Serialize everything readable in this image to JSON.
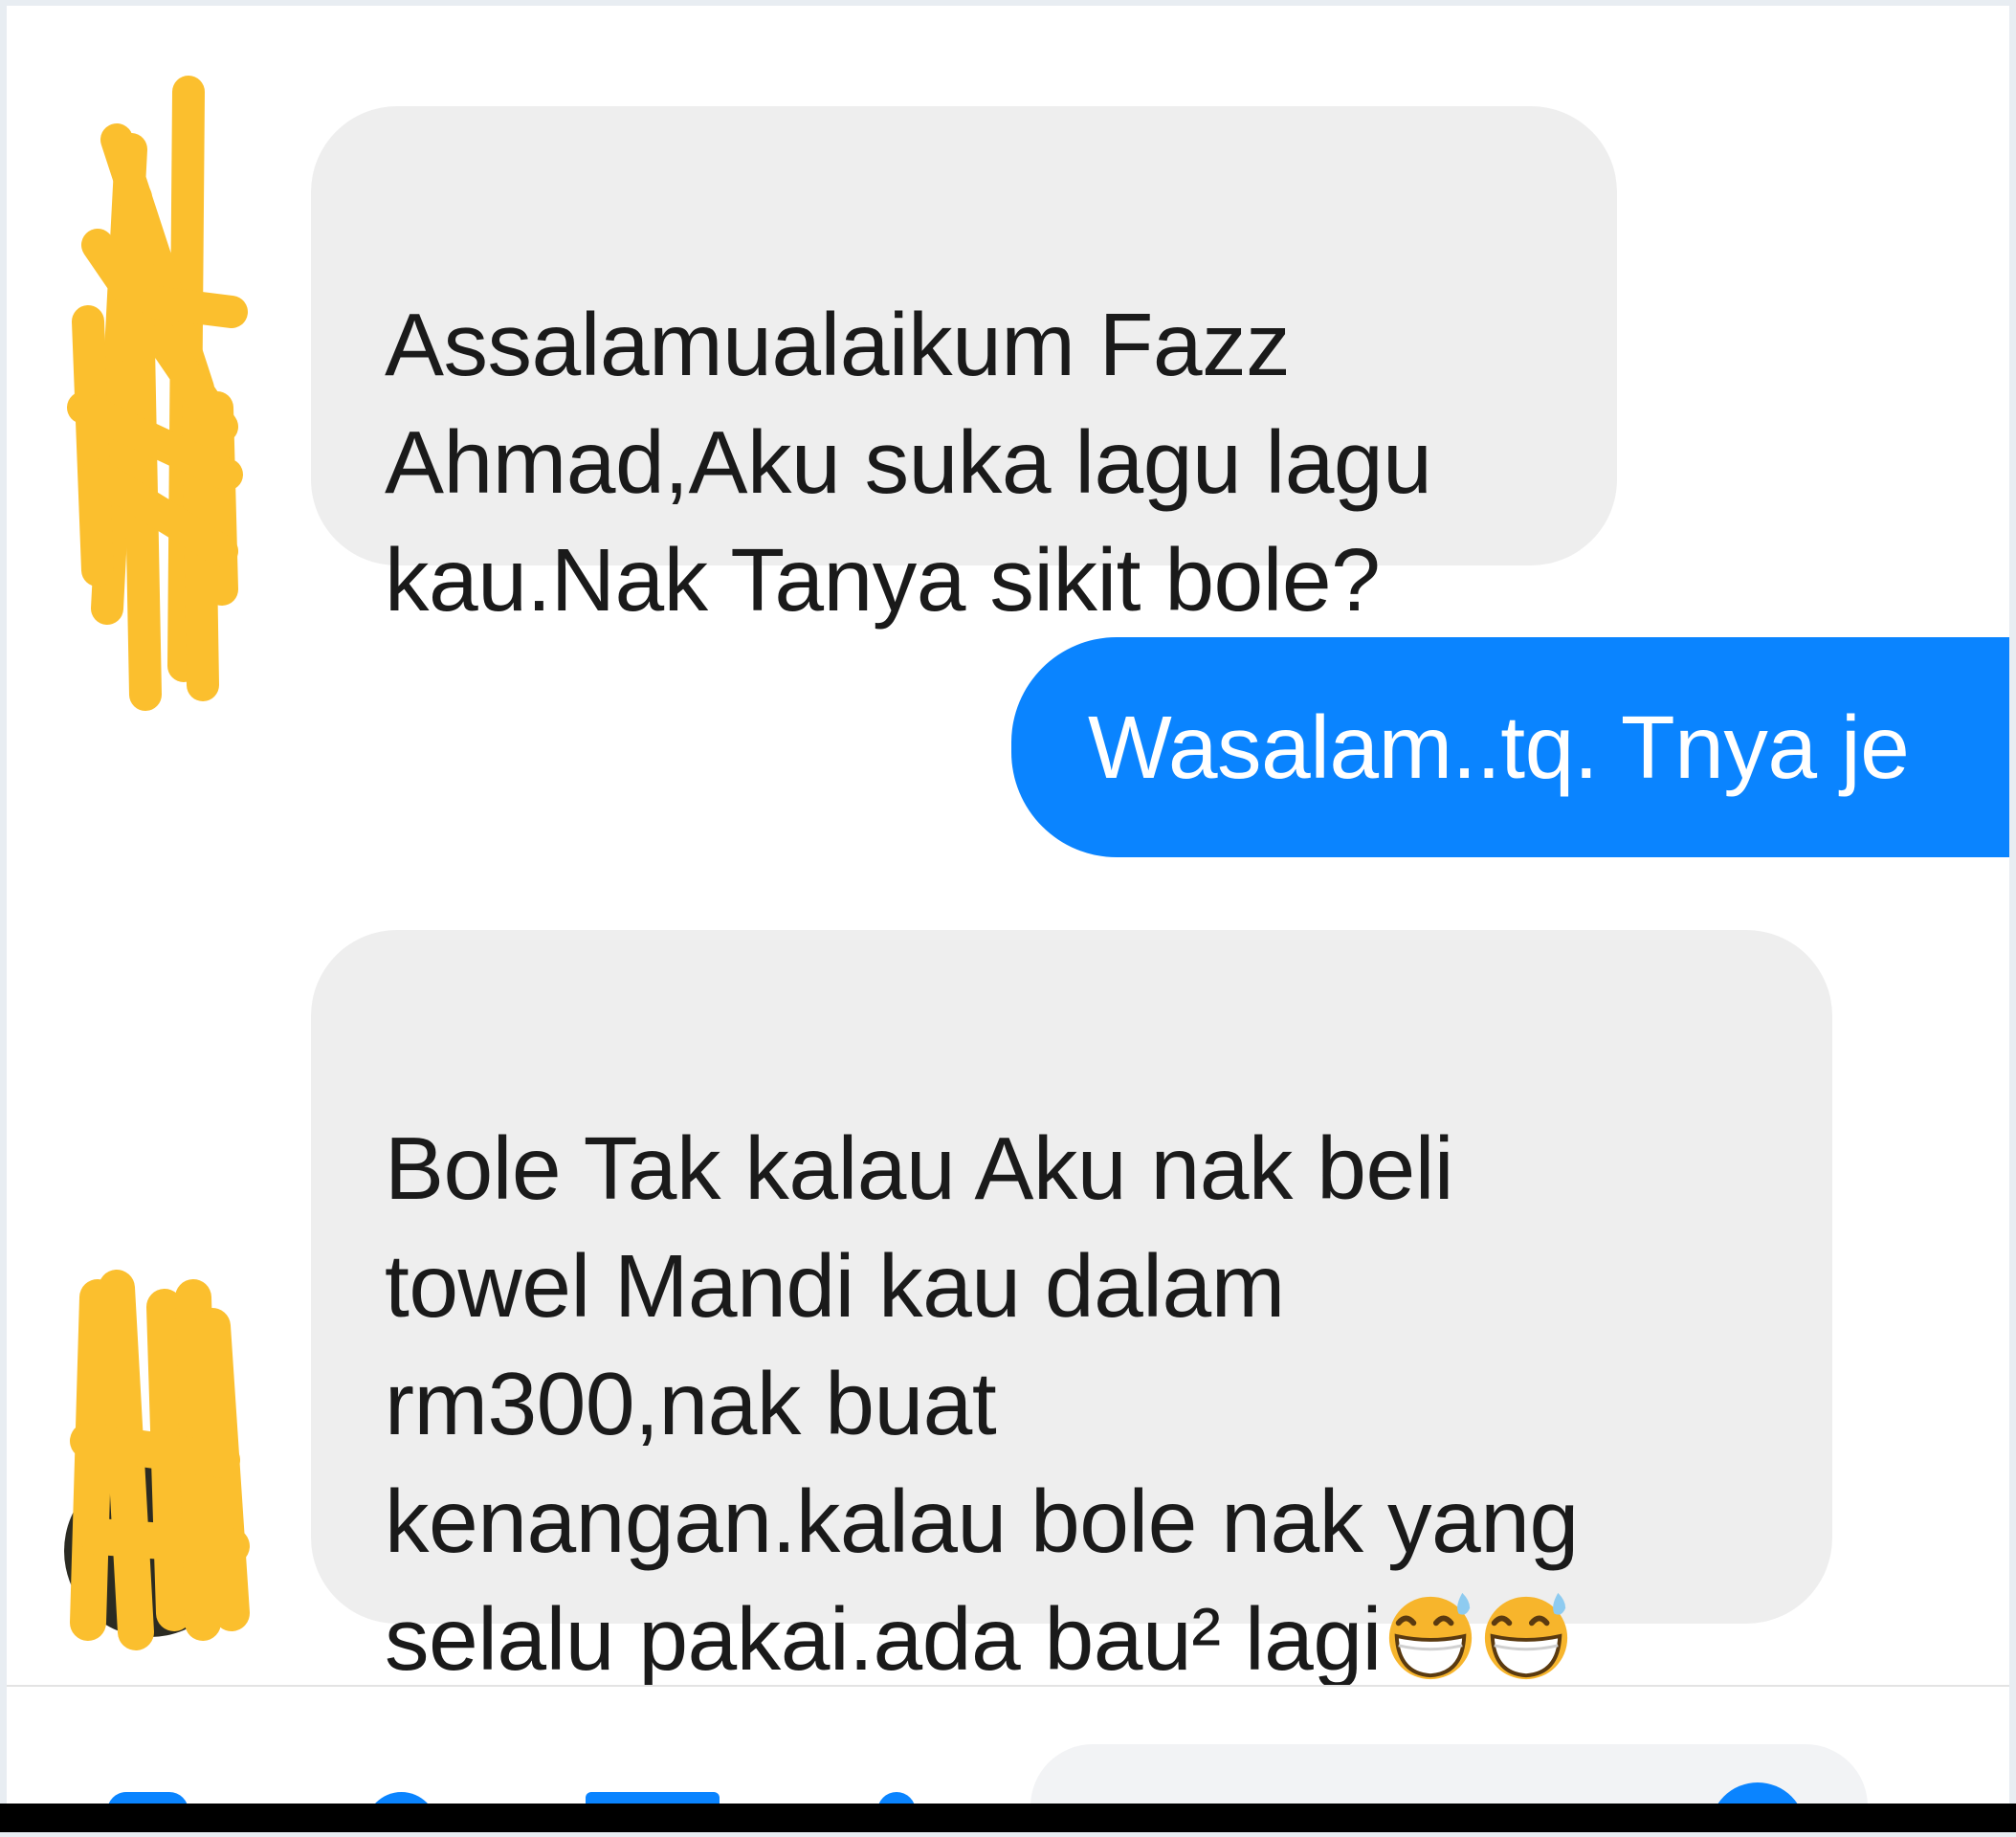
{
  "messages": [
    {
      "direction": "incoming",
      "text": "Assalamualaikum Fazz\nAhmad,Aku suka lagu lagu\nkau.Nak Tanya sikit bole?"
    },
    {
      "direction": "outgoing",
      "text": "Wasalam..tq. Tnya je"
    },
    {
      "direction": "incoming",
      "text": "Bole Tak kalau Aku nak beli\ntowel Mandi kau dalam\nrm300,nak buat\nkenangan.kalau bole nak yang\nselalu pakai.ada bau² lagi"
    }
  ],
  "emojis": [
    "grinning-face-with-sweat-icon",
    "grinning-face-with-sweat-icon"
  ],
  "colors": {
    "incoming_bubble": "#eeeeee",
    "outgoing_bubble": "#0a84ff",
    "redaction": "#fbbf2e"
  }
}
